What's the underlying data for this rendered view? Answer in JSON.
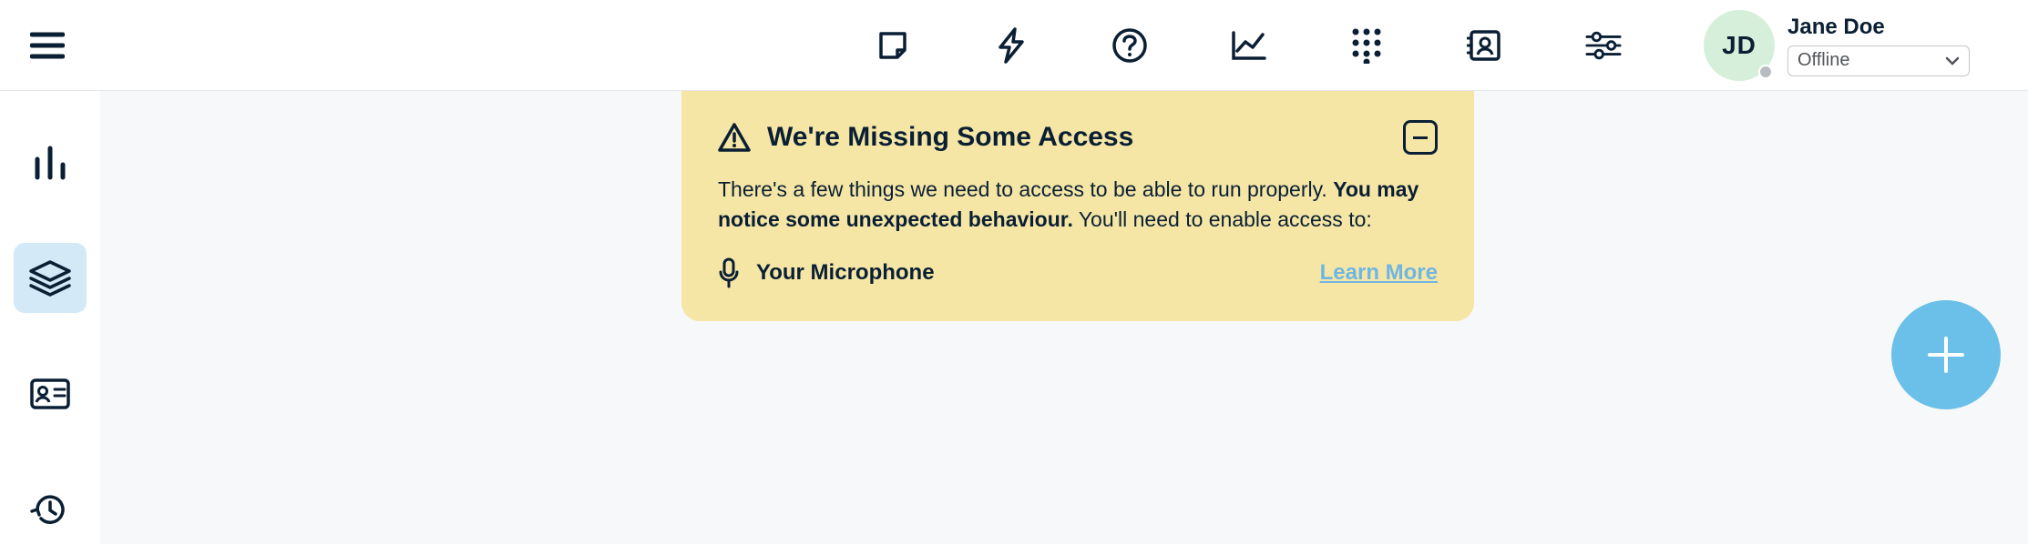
{
  "header": {
    "icons": [
      "note-icon",
      "bolt-icon",
      "help-icon",
      "chart-line-icon",
      "dialpad-icon",
      "contacts-icon",
      "settings-sliders-icon"
    ]
  },
  "user": {
    "name": "Jane Doe",
    "initials": "JD",
    "status": "Offline"
  },
  "sidebar": {
    "items": [
      {
        "name": "bars-chart-icon",
        "active": false
      },
      {
        "name": "layers-icon",
        "active": true
      },
      {
        "name": "id-card-icon",
        "active": false
      },
      {
        "name": "history-icon",
        "active": false
      }
    ]
  },
  "notice": {
    "title": "We're Missing Some Access",
    "body_part1": "There's a few things we need to access to be able to run properly. ",
    "body_bold": "You may notice some unexpected behaviour.",
    "body_part2": " You'll need to enable access to:",
    "access_item": "Your Microphone",
    "learn_more": "Learn More"
  },
  "fab": {
    "label": "+"
  }
}
